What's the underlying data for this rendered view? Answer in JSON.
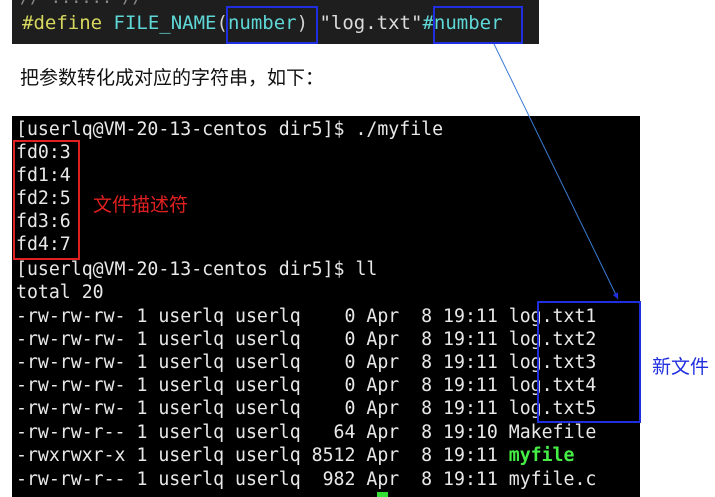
{
  "code": {
    "cut_text": "…(partially visible line)…",
    "keyword": "#define",
    "macro_name": "FILE_NAME",
    "paren_open": "(",
    "param": "number",
    "paren_close": ")",
    "string": "\"log.txt\"",
    "stringify": "#number"
  },
  "caption": "把参数转化成对应的字符串，如下：",
  "terminal": {
    "lines": [
      "[userlq@VM-20-13-centos dir5]$ ./myfile",
      "fd0:3",
      "fd1:4",
      "fd2:5",
      "fd3:6",
      "fd4:7",
      "[userlq@VM-20-13-centos dir5]$ ll",
      "total 20",
      "-rw-rw-rw- 1 userlq userlq    0 Apr  8 19:11 log.txt1",
      "-rw-rw-rw- 1 userlq userlq    0 Apr  8 19:11 log.txt2",
      "-rw-rw-rw- 1 userlq userlq    0 Apr  8 19:11 log.txt3",
      "-rw-rw-rw- 1 userlq userlq    0 Apr  8 19:11 log.txt4",
      "-rw-rw-rw- 1 userlq userlq    0 Apr  8 19:11 log.txt5",
      "-rw-rw-r-- 1 userlq userlq   64 Apr  8 19:10 Makefile",
      "-rwxrwxr-x 1 userlq userlq 8512 Apr  8 19:11 ",
      "-rw-rw-r-- 1 userlq userlq  982 Apr  8 19:11 myfile.c"
    ],
    "executable_name": "myfile"
  },
  "annotations": {
    "fd_label": "文件描述符",
    "newfile_label": "新文件"
  },
  "colors": {
    "highlight_blue": "#1f2fe0",
    "highlight_red": "#e02020",
    "executable_green": "#44ee44"
  }
}
